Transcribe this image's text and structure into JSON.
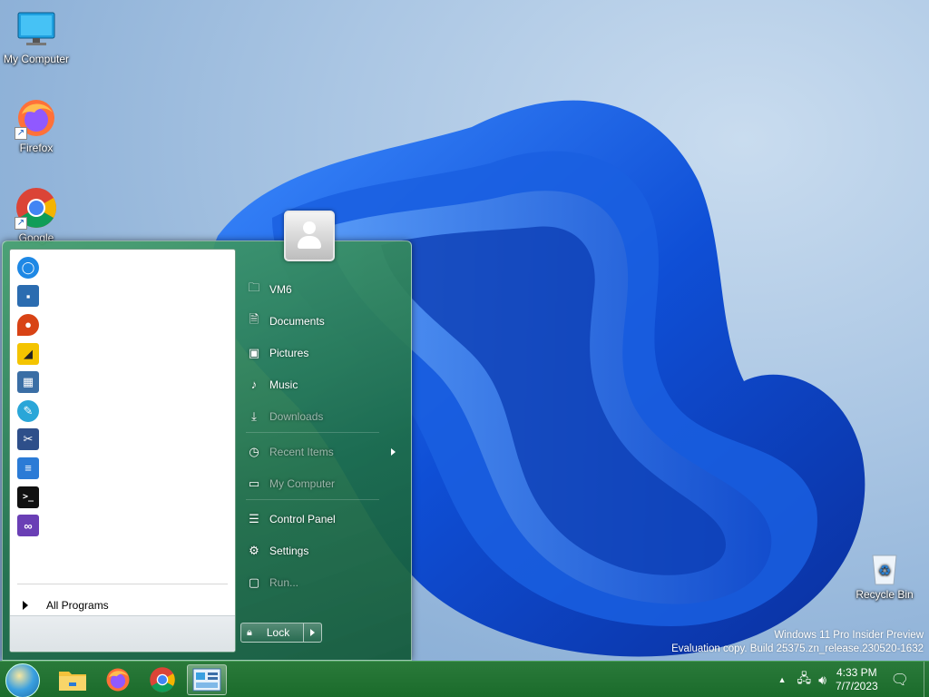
{
  "desktop": {
    "icons": [
      {
        "label": "My Computer",
        "icon": "monitor-icon"
      },
      {
        "label": "Firefox",
        "icon": "firefox-icon"
      },
      {
        "label": "Google",
        "icon": "chrome-icon"
      },
      {
        "label": "Recycle Bin",
        "icon": "recycle-bin-icon"
      }
    ]
  },
  "start_menu": {
    "pinned": [
      {
        "icon": "tips-icon",
        "color": "#1e88e5"
      },
      {
        "icon": "get-help-icon",
        "color": "#2b6cb0"
      },
      {
        "icon": "maps-icon",
        "color": "#d84315"
      },
      {
        "icon": "sticky-notes-icon",
        "color": "#f4c400"
      },
      {
        "icon": "calculator-icon",
        "color": "#3a6ea5"
      },
      {
        "icon": "paint-icon",
        "color": "#2aa6d8"
      },
      {
        "icon": "snipping-tool-icon",
        "color": "#2e4f8a"
      },
      {
        "icon": "notepad-icon",
        "color": "#2b7bd6"
      },
      {
        "icon": "terminal-icon",
        "color": "#111111"
      },
      {
        "icon": "visual-studio-installer-icon",
        "color": "#6a3fb5"
      }
    ],
    "all_programs": "All Programs",
    "right": {
      "vm6": "VM6",
      "documents": "Documents",
      "pictures": "Pictures",
      "music": "Music",
      "downloads": "Downloads",
      "recent": "Recent Items",
      "my_computer": "My Computer",
      "control_panel": "Control Panel",
      "settings": "Settings",
      "run": "Run..."
    },
    "lock": "Lock"
  },
  "watermark": {
    "line1": "Windows 11 Pro Insider Preview",
    "line2": "Evaluation copy. Build 25375.zn_release.230520-1632"
  },
  "taskbar": {
    "apps": [
      "file-explorer-icon",
      "firefox-icon",
      "chrome-icon",
      "control-panel-icon"
    ],
    "time": "4:33 PM",
    "date": "7/7/2023"
  },
  "colors": {
    "taskbar": "#1f6f30",
    "start_menu": "#2e8a5a",
    "wallpaper_blue": "#1a5fe0"
  }
}
